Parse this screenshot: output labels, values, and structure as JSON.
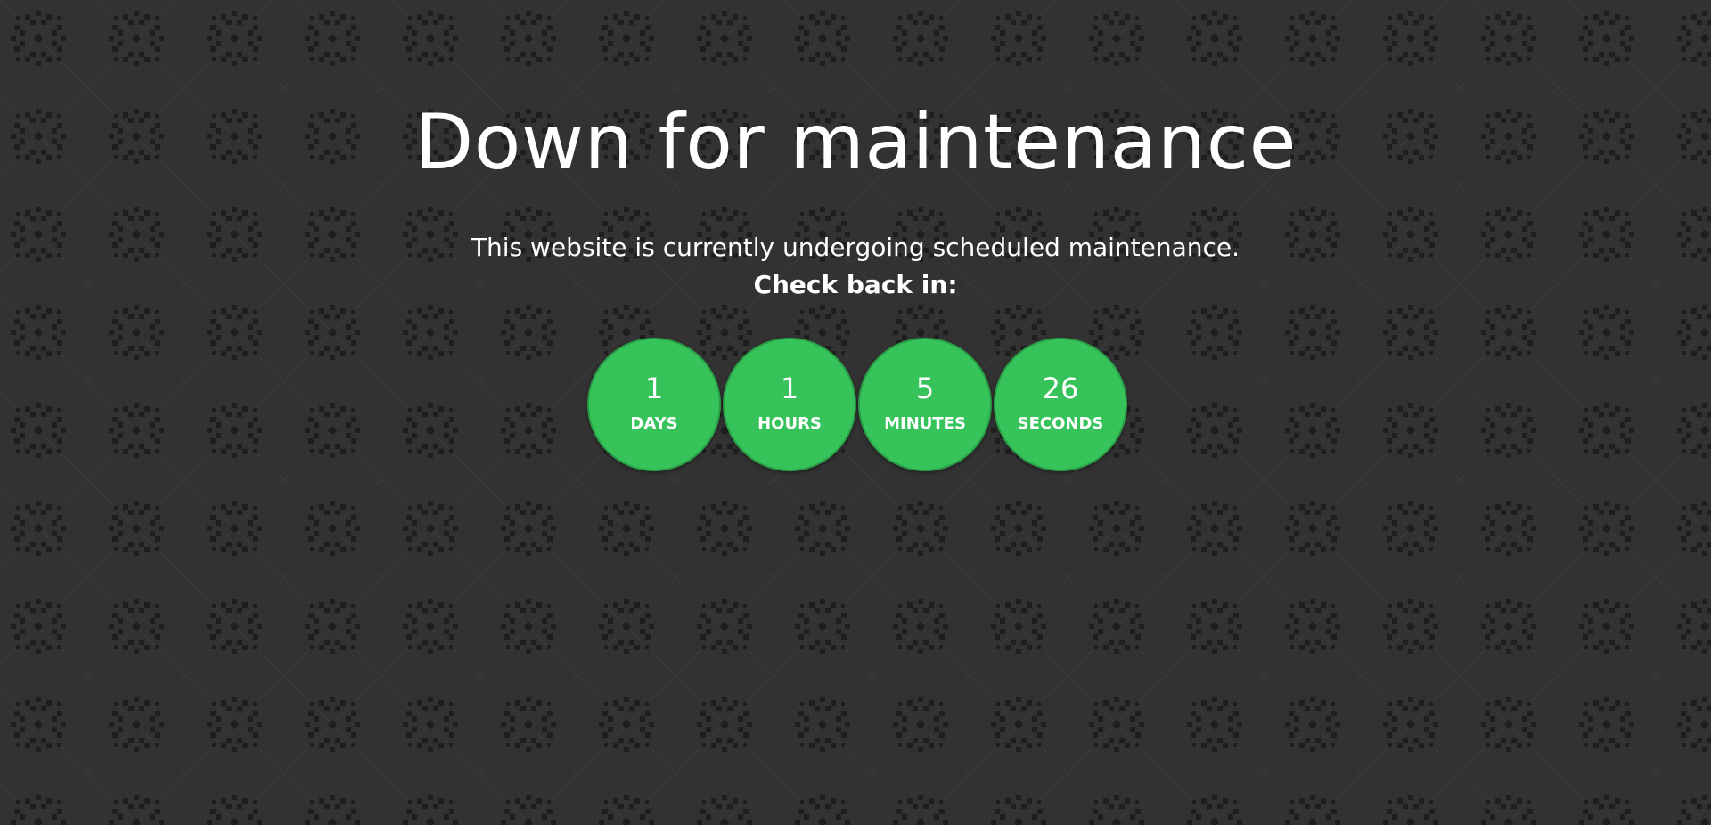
{
  "page": {
    "title": "Down for maintenance",
    "description": "This website is currently undergoing scheduled maintenance.",
    "check_back": "Check back in:"
  },
  "countdown": [
    {
      "value": "1",
      "label": "DAYS"
    },
    {
      "value": "1",
      "label": "HOURS"
    },
    {
      "value": "5",
      "label": "MINUTES"
    },
    {
      "value": "26",
      "label": "SECONDS"
    }
  ],
  "colors": {
    "background": "#323232",
    "pattern": "#1f1f1f",
    "accent_green": "#36c35a",
    "text": "#ffffff"
  }
}
